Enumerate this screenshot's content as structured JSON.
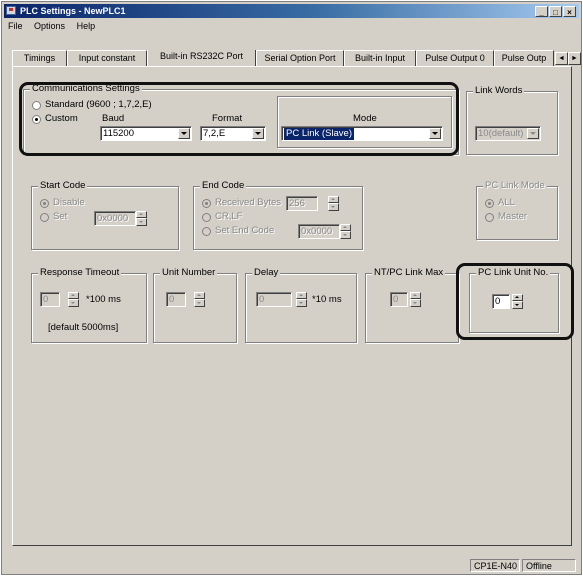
{
  "window": {
    "title": "PLC Settings - NewPLC1",
    "controls": [
      "minimize-icon",
      "maximize-icon",
      "close-icon"
    ],
    "minimize_glyph": "_",
    "maximize_glyph": "□",
    "close_glyph": "×"
  },
  "menu": [
    "File",
    "Options",
    "Help"
  ],
  "tabs": [
    {
      "label": "Timings"
    },
    {
      "label": "Input constant"
    },
    {
      "label": "Built-in RS232C Port",
      "active": true
    },
    {
      "label": "Serial Option Port"
    },
    {
      "label": "Built-in Input"
    },
    {
      "label": "Pulse Output 0"
    },
    {
      "label": "Pulse Outp"
    }
  ],
  "tab_scroll": {
    "left": "◄",
    "right": "►"
  },
  "comm": {
    "title": "Communications Settings",
    "standard_label": "Standard (9600 ; 1,7,2,E)",
    "custom_label": "Custom",
    "baud_label": "Baud",
    "baud_value": "115200",
    "format_label": "Format",
    "format_value": "7,2,E",
    "mode_label": "Mode",
    "mode_value": "PC Link (Slave)",
    "selected": "Custom"
  },
  "link_words": {
    "title": "Link Words",
    "value": "10(default)"
  },
  "start_code": {
    "title": "Start Code",
    "disable_label": "Disable",
    "set_label": "Set",
    "value": "0x0000"
  },
  "end_code": {
    "title": "End Code",
    "received_label": "Received Bytes",
    "received_value": "256",
    "crlf_label": "CR,LF",
    "set_label": "Set End Code",
    "set_value": "0x0000"
  },
  "pc_link_mode": {
    "title": "PC Link Mode",
    "all_label": "ALL",
    "master_label": "Master"
  },
  "response_timeout": {
    "title": "Response Timeout",
    "value": "0",
    "unit": "*100 ms",
    "note": "[default 5000ms]"
  },
  "unit_number": {
    "title": "Unit Number",
    "value": "0"
  },
  "delay": {
    "title": "Delay",
    "value": "0",
    "unit": "*10 ms"
  },
  "nt_pc_link_max": {
    "title": "NT/PC Link Max",
    "value": "0"
  },
  "pc_link_unit_no": {
    "title": "PC Link Unit No.",
    "value": "0"
  },
  "status": {
    "model": "CP1E-N40",
    "state": "Offline"
  }
}
